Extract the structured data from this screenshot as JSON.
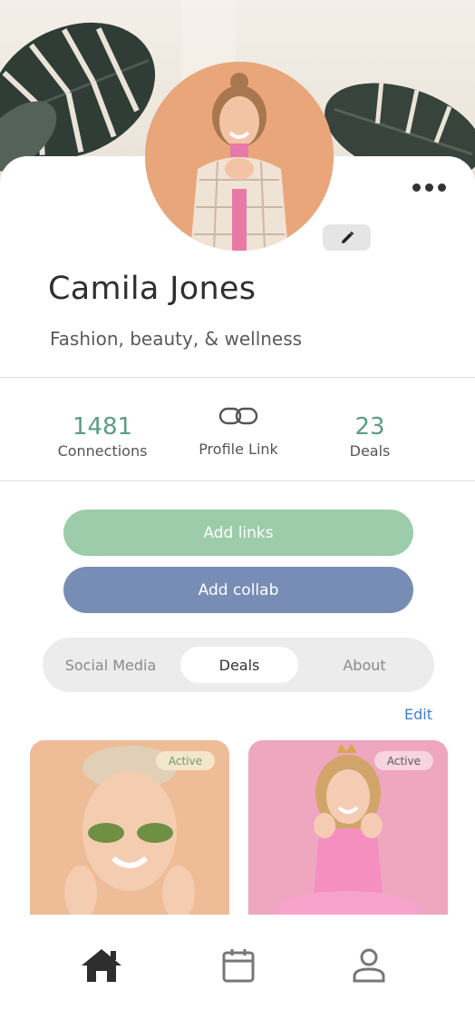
{
  "profile": {
    "name": "Camila Jones",
    "bio": "Fashion, beauty, & wellness"
  },
  "stats": {
    "connections_value": "1481",
    "connections_label": "Connections",
    "profile_link_label": "Profile Link",
    "deals_value": "23",
    "deals_label": "Deals"
  },
  "actions": {
    "add_links": "Add links",
    "add_collab": "Add collab"
  },
  "tabs": [
    {
      "label": "Social Media",
      "active": false
    },
    {
      "label": "Deals",
      "active": true
    },
    {
      "label": "About",
      "active": false
    }
  ],
  "edit_label": "Edit",
  "deals": [
    {
      "status": "Active",
      "image": "woman-with-eye-patches"
    },
    {
      "status": "Active",
      "image": "woman-in-pink-with-crown"
    }
  ],
  "nav": [
    {
      "icon": "home-icon",
      "active": true
    },
    {
      "icon": "calendar-icon",
      "active": false
    },
    {
      "icon": "profile-icon",
      "active": false
    }
  ],
  "colors": {
    "accent_green": "#9ccca9",
    "accent_blue": "#788db5",
    "stat_green": "#5a9e80",
    "link_blue": "#3f7fd6"
  }
}
